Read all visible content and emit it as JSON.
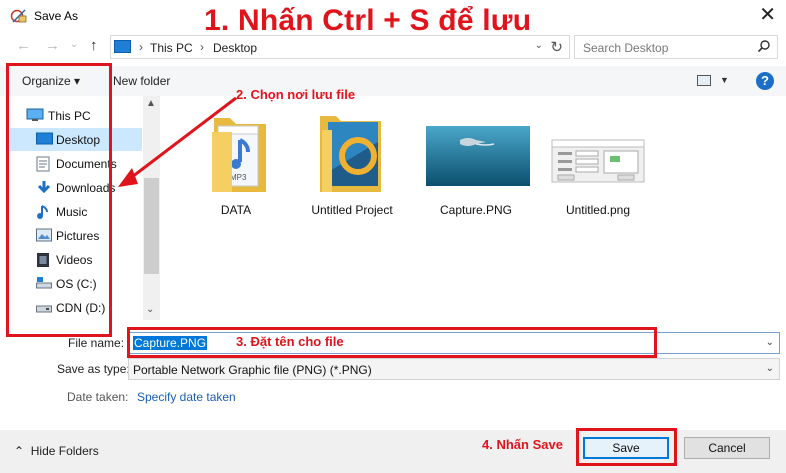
{
  "window": {
    "title": "Save As",
    "close_glyph": "✕"
  },
  "annotations": {
    "title": "1. Nhấn Ctrl + S để lưu",
    "choose_location": "2. Chọn nơi lưu file",
    "name_file": "3. Đặt tên cho file",
    "press_save": "4. Nhấn Save",
    "color": "#e0141b"
  },
  "navigation": {
    "back_glyph": "←",
    "forward_glyph": "→",
    "dropdown_glyph": "⌄",
    "up_glyph": "↑",
    "breadcrumb": [
      "This PC",
      "Desktop"
    ],
    "separator": "›",
    "refresh_glyph": "↻",
    "search_placeholder": "Search Desktop"
  },
  "toolbar": {
    "organize_label": "Organize ▾",
    "new_folder_label": "New folder",
    "view_drop": "▼",
    "help_label": "?"
  },
  "sidebar": {
    "items": [
      {
        "label": "This PC",
        "icon": "pc-icon"
      },
      {
        "label": "Desktop",
        "icon": "desktop-icon"
      },
      {
        "label": "Documents",
        "icon": "documents-icon"
      },
      {
        "label": "Downloads",
        "icon": "downloads-icon"
      },
      {
        "label": "Music",
        "icon": "music-icon"
      },
      {
        "label": "Pictures",
        "icon": "pictures-icon"
      },
      {
        "label": "Videos",
        "icon": "videos-icon"
      },
      {
        "label": "OS (C:)",
        "icon": "drive-icon"
      },
      {
        "label": "CDN (D:)",
        "icon": "drive-icon"
      }
    ],
    "selected": "Desktop",
    "scroll_up": "▲",
    "scroll_down": "⌄"
  },
  "files": [
    {
      "name": "DATA",
      "icon": "mp3-folder-icon"
    },
    {
      "name": "Untitled Project",
      "icon": "project-folder-icon"
    },
    {
      "name": "Capture.PNG",
      "icon": "image-thumbnail"
    },
    {
      "name": "Untitled.png",
      "icon": "dialog-thumbnail"
    }
  ],
  "form": {
    "file_name_label": "File name:",
    "file_name_value": "Capture.PNG",
    "save_as_type_label": "Save as type:",
    "save_as_type_value": "Portable Network Graphic file (PNG) (*.PNG)",
    "date_taken_label": "Date taken:",
    "date_taken_link": "Specify date taken",
    "dropdown_glyph": "⌄"
  },
  "bottom": {
    "hide_folders_label": "Hide Folders",
    "hide_glyph": "⌃",
    "save_label": "Save",
    "cancel_label": "Cancel"
  },
  "colors": {
    "accent": "#0078d7",
    "selection": "#cce8ff",
    "link": "#1a5fb4"
  }
}
